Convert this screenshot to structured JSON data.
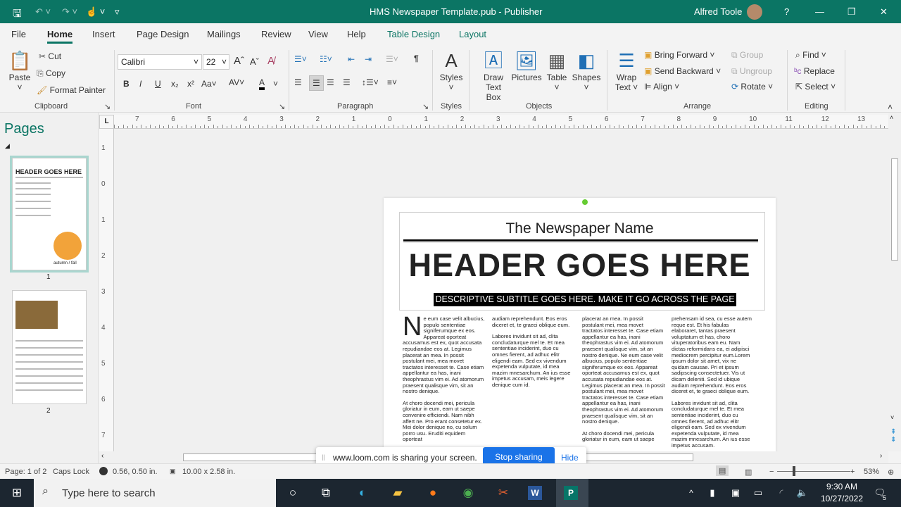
{
  "title_bar": {
    "title": "HMS Newspaper Template.pub  -  Publisher",
    "user": "Alfred Toole",
    "help": "?",
    "icons": [
      "save-icon",
      "undo-icon",
      "redo-icon",
      "touch-mode-icon",
      "customize-icon"
    ]
  },
  "tabs": [
    "File",
    "Home",
    "Insert",
    "Page Design",
    "Mailings",
    "Review",
    "View",
    "Help",
    "Table Design",
    "Layout"
  ],
  "ribbon": {
    "clipboard": {
      "paste": "Paste",
      "cut": "Cut",
      "copy": "Copy",
      "format_painter": "Format Painter",
      "label": "Clipboard"
    },
    "font": {
      "name": "Calibri",
      "size": "22",
      "label": "Font"
    },
    "paragraph": {
      "label": "Paragraph"
    },
    "styles": {
      "button": "Styles",
      "label": "Styles"
    },
    "objects": {
      "draw_text_box_1": "Draw",
      "draw_text_box_2": "Text Box",
      "pictures": "Pictures",
      "table": "Table",
      "shapes": "Shapes",
      "label": "Objects"
    },
    "arrange": {
      "wrap_1": "Wrap",
      "wrap_2": "Text",
      "bring_forward": "Bring Forward",
      "send_backward": "Send Backward",
      "align": "Align",
      "group": "Group",
      "ungroup": "Ungroup",
      "rotate": "Rotate",
      "label": "Arrange"
    },
    "editing": {
      "find": "Find",
      "replace": "Replace",
      "select": "Select",
      "label": "Editing"
    }
  },
  "pages_pane": {
    "title": "Pages",
    "pages": [
      {
        "number": "1",
        "selected": true
      },
      {
        "number": "2",
        "selected": false
      }
    ],
    "thumb1_title": "HEADER GOES HERE",
    "thumb1_caption": "autumn / fall"
  },
  "rulers": {
    "horizontal": [
      "7",
      "6",
      "5",
      "4",
      "3",
      "2",
      "1",
      "0",
      "1",
      "2",
      "3",
      "4",
      "5",
      "6",
      "7",
      "8",
      "9",
      "10",
      "11",
      "12",
      "13"
    ],
    "vertical": [
      "1",
      "0",
      "1",
      "2",
      "3",
      "4",
      "5",
      "6",
      "7"
    ]
  },
  "document": {
    "newspaper_name": "The Newspaper Name",
    "header": "HEADER GOES HERE",
    "subtitle": "DESCRIPTIVE SUBTITLE GOES HERE.  MAKE IT GO ACROSS THE PAGE",
    "drop_cap": "N",
    "columns": [
      [
        "e eum case velit albucius, populo sententiae signiferumque ex eos. Appareat oporteat accusamus est ex, quot accusata repudiandae eos at. Legimus placerat an mea. In possit postulant mei, mea movet tractatos interesset te. Case etiam appellantur ea has, inani theophrastus vim ei. Ad atomorum praesent qualisque vim, sit an nostro denique.",
        "At choro docendi mei, pericula gloriatur in eum, eam ut saepe convenire efficiendi. Nam nibh affert ne. Pro erant consetetur ex. Mei dolor denique no, cu solum porro usu. Eruditi equidem oporteat"
      ],
      [
        "audiam reprehendunt. Eos eros diceret et, te graeci oblique eum.",
        "Labores invidunt sit ad, clita concludaturque mel te. Et mea sententiae inciderint, duo cu omnes fierent, ad adhuc elitr eligendi eam. Sed ex vivendum expetenda vulputate, id mea mazim mnesarchum. An ius esse impetus accusam, meis legere denique cum id."
      ],
      [
        "placerat an mea. In possit postulant mei, mea movet tractatos interesset te. Case etiam appellantur ea has, inani theophrastus vim ei. Ad atomorum praesent qualisque vim, sit an nostro denique. Ne eum case velit albucius, populo sententiae signiferumque ex eos. Appareat oporteat accusamus est ex, quot accusata repudiandae eos at. Legimus placerat an mea. In possit postulant mei, mea movet tractatos interesset te. Case etiam appellantur ea has, inani theophrastus vim ei. Ad atomorum praesent qualisque vim, sit an nostro denique.",
        "At choro docendi mei, pericula gloriatur in eum, eam ut saepe"
      ],
      [
        "prehensam id sea, cu esse autem reque est. Et his fabulas elaboraret, tantas praesent voluptatum et has, choro vituperatoribus eam eu. Nam dictas reformidans ea, ei adipisci mediocrem percipitur eum.Lorem ipsum dolor sit amet, vix ne quidam causae. Pri et ipsum sadipscing consectetuer. Vis ut dicam deleniti. Sed id ubique audiam reprehendunt. Eos eros diceret et, te graeci oblique eum.",
        "Labores invidunt sit ad, clita concludaturque mel te. Et mea sententiae inciderint, duo cu omnes fierent, ad adhuc elitr eligendi eam. Sed ex vivendum expetenda vulputate, id mea mazim mnesarchum. An ius esse impetus accusam."
      ]
    ]
  },
  "loom": {
    "message": "www.loom.com is sharing your screen.",
    "stop": "Stop sharing",
    "hide": "Hide"
  },
  "status_bar": {
    "page": "Page: 1 of 2",
    "caps": "Caps Lock",
    "position": "0.56, 0.50 in.",
    "size": "10.00 x 2.58 in.",
    "zoom": "53%",
    "zoom_level": 53
  },
  "taskbar": {
    "search_placeholder": "Type here to search",
    "time": "9:30 AM",
    "date": "10/27/2022",
    "notifications": "5"
  },
  "colors": {
    "accent": "#0b7564",
    "link": "#1a73e8"
  }
}
